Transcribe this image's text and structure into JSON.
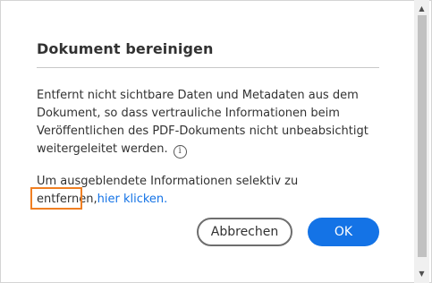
{
  "dialog": {
    "title": "Dokument bereinigen",
    "description": "Entfernt nicht sichtbare Daten und Metadaten aus dem Dokument, so dass vertrauliche Informationen beim Veröffentlichen des PDF-Dokuments nicht unbeabsichtigt weitergeleitet werden.",
    "info_icon_glyph": "i",
    "selective_text": "Um ausgeblendete Informationen selektiv zu entfernen,",
    "selective_link": "hier klicken",
    "selective_suffix": ".",
    "cancel_label": "Abbrechen",
    "ok_label": "OK"
  },
  "scrollbar": {
    "up_glyph": "▲",
    "down_glyph": "▼"
  },
  "colors": {
    "accent": "#1473e6",
    "focus": "#f07f22",
    "text": "#323232"
  }
}
